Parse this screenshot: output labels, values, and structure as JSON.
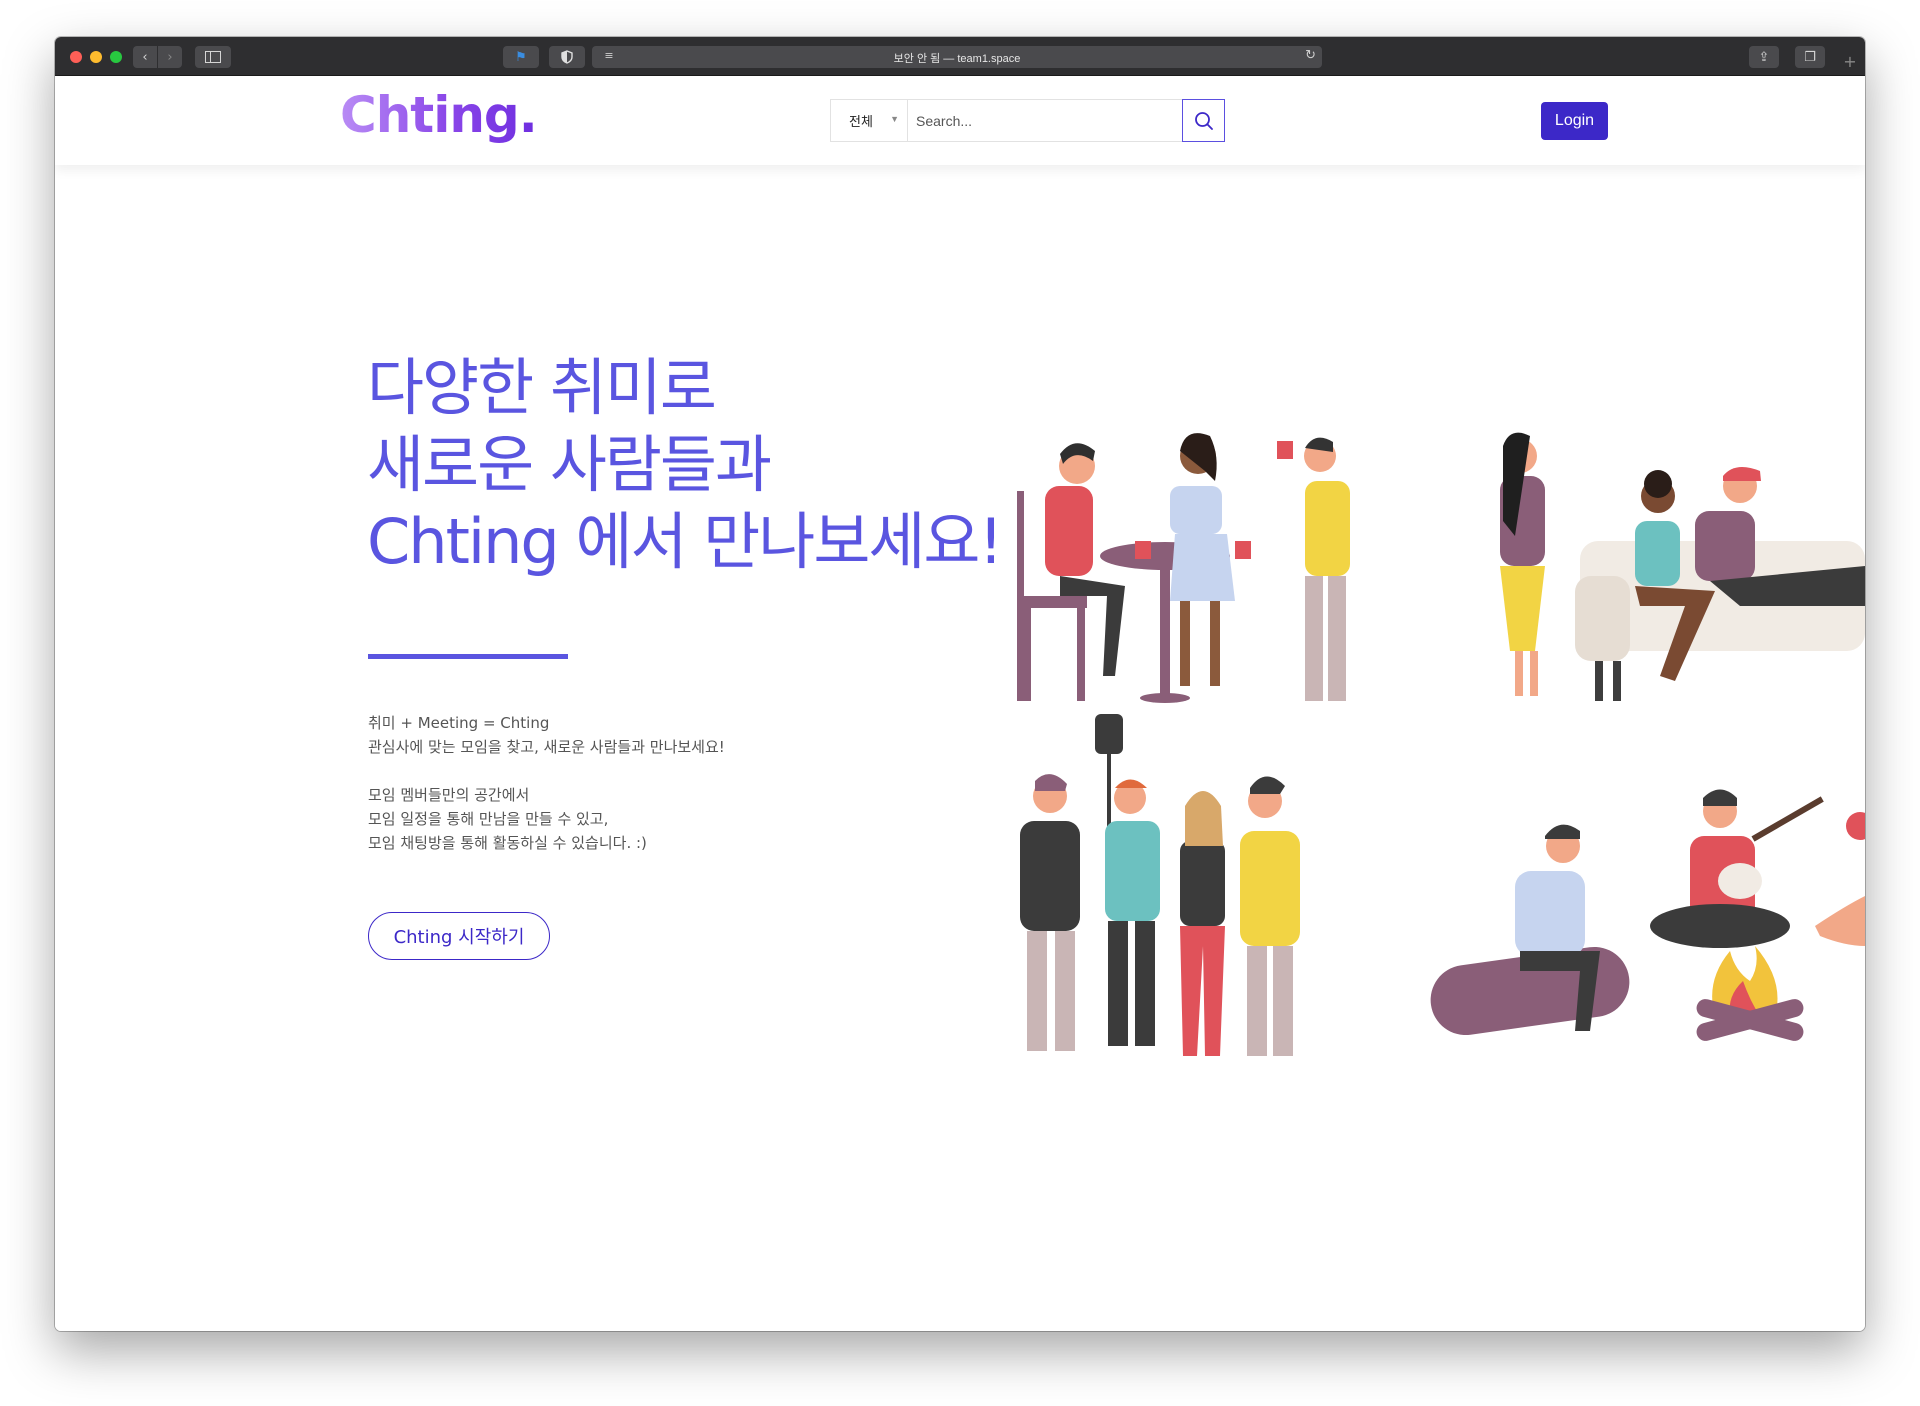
{
  "browser": {
    "address_text": "보안 안 됨 — team1.space"
  },
  "navbar": {
    "logo": "Chting.",
    "category_selected": "전체",
    "search_placeholder": "Search...",
    "login_label": "Login"
  },
  "hero": {
    "headline_lines": [
      "다양한 취미로",
      "새로운 사람들과",
      "Chting 에서 만나보세요!"
    ],
    "description": {
      "line1": "취미 + Meeting = Chting",
      "line2": "관심사에 맞는 모임을 찾고, 새로운 사람들과 만나보세요!",
      "line3": "모임 멤버들만의 공간에서",
      "line4": "모임 일정을 통해 만남을 만들 수 있고,",
      "line5": "모임 채팅방을 통해 활동하실 수 있습니다. :)"
    },
    "cta_label": "Chting 시작하기"
  },
  "colors": {
    "accent": "#5a55e0",
    "primary_button": "#3c28c8",
    "logo_gradient": [
      "#b98cf5",
      "#6e2ee0"
    ]
  },
  "icons": [
    "back-icon",
    "forward-icon",
    "sidebar-icon",
    "shield-icon",
    "reader-icon",
    "reload-icon",
    "share-icon",
    "tabs-icon",
    "plus-icon",
    "search-icon",
    "chevron-down-icon"
  ]
}
